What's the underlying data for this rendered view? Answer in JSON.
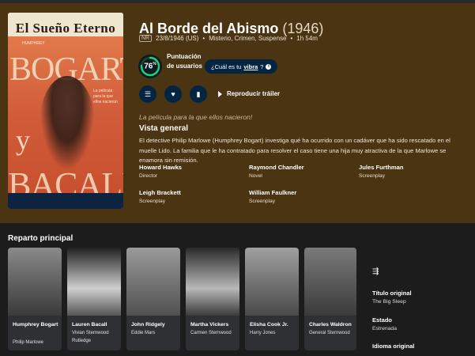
{
  "poster": {
    "title": "El Sueño Eterno",
    "big_top": "BOGART",
    "big_mid": "y",
    "big_bottom": "BACALL",
    "small_top": "HUMPHREY",
    "small_text": "La película para la que ellos nacieron"
  },
  "movie": {
    "title": "Al Borde del Abismo",
    "year": "(1946)",
    "certification": "NR",
    "release": "23/8/1946 (US)",
    "genres": "Misterio, Crimen, Suspense",
    "runtime": "1h 54m",
    "score": "76",
    "score_unit": "%",
    "score_percent": 76,
    "score_label": "Puntuación de usuarios",
    "vibe_prefix": "¿Cuál es tu ",
    "vibe_link": "vibra",
    "vibe_suffix": "?",
    "trailer_label": "Reproducir tráiler",
    "tagline": "La película para la que ellos nacieron!",
    "overview_heading": "Vista general",
    "overview": "El detective Philip Marlowe (Humphrey Bogart) investiga qué ha ocurrido con un cadáver que ha sido rescatado en el muelle Lido. La familia que le ha contratado para resolver el caso tiene una hija muy atractiva de la que Marlowe se enamora sin remisión."
  },
  "crew": [
    {
      "name": "Howard Hawks",
      "role": "Director"
    },
    {
      "name": "Raymond Chandler",
      "role": "Novel"
    },
    {
      "name": "Jules Furthman",
      "role": "Screenplay"
    },
    {
      "name": "Leigh Brackett",
      "role": "Screenplay"
    },
    {
      "name": "William Faulkner",
      "role": "Screenplay"
    }
  ],
  "cast_heading": "Reparto principal",
  "cast": [
    {
      "name": "Humphrey Bogart",
      "character": "Philip Marlowe"
    },
    {
      "name": "Lauren Bacall",
      "character": "Vivian Sternwood Rutledge"
    },
    {
      "name": "John Ridgely",
      "character": "Eddie Mars"
    },
    {
      "name": "Martha Vickers",
      "character": "Carmen Sternwood"
    },
    {
      "name": "Elisha Cook Jr.",
      "character": "Harry Jones"
    },
    {
      "name": "Charles Waldron",
      "character": "General Sternwood"
    }
  ],
  "facts": {
    "original_title_label": "Título original",
    "original_title": "The Big Sleep",
    "status_label": "Estado",
    "status": "Estrenada",
    "language_label": "Idioma original"
  },
  "colors": {
    "hero_bg": "#4a3411",
    "button_bg": "#032541",
    "score_ring": "#21d07a"
  },
  "icons": [
    "list-icon",
    "heart-icon",
    "bookmark-icon",
    "play-icon",
    "info-icon",
    "social-links-icon"
  ]
}
